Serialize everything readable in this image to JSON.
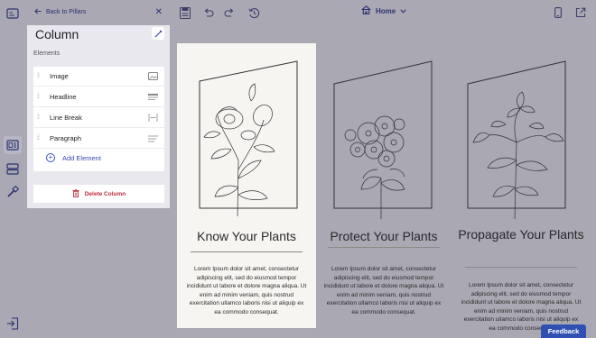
{
  "panel": {
    "back_label": "Back to Pillars",
    "title": "Column",
    "section_label": "Elements",
    "elements": [
      {
        "label": "Image",
        "icon": "image-icon"
      },
      {
        "label": "Headline",
        "icon": "headline-icon"
      },
      {
        "label": "Line Break",
        "icon": "line-break-icon"
      },
      {
        "label": "Paragraph",
        "icon": "paragraph-icon"
      }
    ],
    "add_label": "Add Element",
    "delete_label": "Delete Column"
  },
  "topbar": {
    "page_label": "Home"
  },
  "columns": [
    {
      "title": "Know Your Plants",
      "body": "Lorem Ipsum dolor sit amet, consectetur adipiscing elit, sed do eiusmod tempor incididunt ut labore et dolore magna aliqua. Ut enim ad minim veniam, quis nostrud exercitation ullamco laboris nisi ut aliquip ex ea commodo consequat."
    },
    {
      "title": "Protect Your Plants",
      "body": "Lorem Ipsum dolor sit amet, consectetur adipiscing elit, sed do eiusmod tempor incididunt ut labore et dolore magna aliqua. Ut enim ad minim veniam, quis nostrud exercitation ullamco laboris nisi ut aliquip ex ea commodo consequat."
    },
    {
      "title": "Propagate Your Plants",
      "body": "Lorem Ipsum dolor sit amet, consectetur adipiscing elit, sed do eiusmod tempor incididunt ut labore et dolore magna aliqua. Ut enim ad minim veniam, quis nostrud exercitation ullamco laboris nisi ut aliquip ex ea commodo consequat."
    }
  ],
  "feedback_label": "Feedback",
  "colors": {
    "accent": "#3a49b7",
    "danger": "#c02b3b",
    "nav": "#2d3270",
    "feedback": "#2f4fb3"
  }
}
